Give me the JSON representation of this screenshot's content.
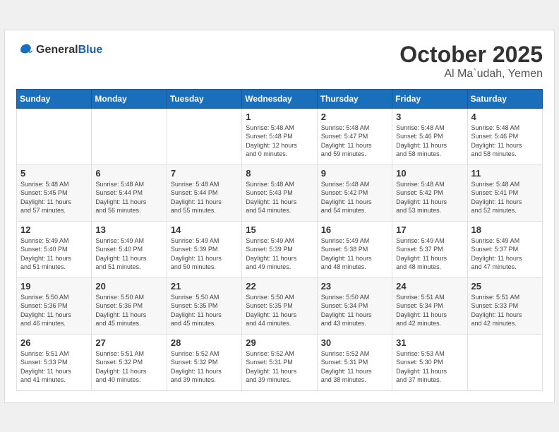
{
  "header": {
    "logo": {
      "general": "General",
      "blue": "Blue"
    },
    "month": "October 2025",
    "location": "Al Ma`udah, Yemen"
  },
  "weekdays": [
    "Sunday",
    "Monday",
    "Tuesday",
    "Wednesday",
    "Thursday",
    "Friday",
    "Saturday"
  ],
  "weeks": [
    [
      {
        "day": "",
        "info": ""
      },
      {
        "day": "",
        "info": ""
      },
      {
        "day": "",
        "info": ""
      },
      {
        "day": "1",
        "info": "Sunrise: 5:48 AM\nSunset: 5:48 PM\nDaylight: 12 hours\nand 0 minutes."
      },
      {
        "day": "2",
        "info": "Sunrise: 5:48 AM\nSunset: 5:47 PM\nDaylight: 11 hours\nand 59 minutes."
      },
      {
        "day": "3",
        "info": "Sunrise: 5:48 AM\nSunset: 5:46 PM\nDaylight: 11 hours\nand 58 minutes."
      },
      {
        "day": "4",
        "info": "Sunrise: 5:48 AM\nSunset: 5:46 PM\nDaylight: 11 hours\nand 58 minutes."
      }
    ],
    [
      {
        "day": "5",
        "info": "Sunrise: 5:48 AM\nSunset: 5:45 PM\nDaylight: 11 hours\nand 57 minutes."
      },
      {
        "day": "6",
        "info": "Sunrise: 5:48 AM\nSunset: 5:44 PM\nDaylight: 11 hours\nand 56 minutes."
      },
      {
        "day": "7",
        "info": "Sunrise: 5:48 AM\nSunset: 5:44 PM\nDaylight: 11 hours\nand 55 minutes."
      },
      {
        "day": "8",
        "info": "Sunrise: 5:48 AM\nSunset: 5:43 PM\nDaylight: 11 hours\nand 54 minutes."
      },
      {
        "day": "9",
        "info": "Sunrise: 5:48 AM\nSunset: 5:42 PM\nDaylight: 11 hours\nand 54 minutes."
      },
      {
        "day": "10",
        "info": "Sunrise: 5:48 AM\nSunset: 5:42 PM\nDaylight: 11 hours\nand 53 minutes."
      },
      {
        "day": "11",
        "info": "Sunrise: 5:48 AM\nSunset: 5:41 PM\nDaylight: 11 hours\nand 52 minutes."
      }
    ],
    [
      {
        "day": "12",
        "info": "Sunrise: 5:49 AM\nSunset: 5:40 PM\nDaylight: 11 hours\nand 51 minutes."
      },
      {
        "day": "13",
        "info": "Sunrise: 5:49 AM\nSunset: 5:40 PM\nDaylight: 11 hours\nand 51 minutes."
      },
      {
        "day": "14",
        "info": "Sunrise: 5:49 AM\nSunset: 5:39 PM\nDaylight: 11 hours\nand 50 minutes."
      },
      {
        "day": "15",
        "info": "Sunrise: 5:49 AM\nSunset: 5:39 PM\nDaylight: 11 hours\nand 49 minutes."
      },
      {
        "day": "16",
        "info": "Sunrise: 5:49 AM\nSunset: 5:38 PM\nDaylight: 11 hours\nand 48 minutes."
      },
      {
        "day": "17",
        "info": "Sunrise: 5:49 AM\nSunset: 5:37 PM\nDaylight: 11 hours\nand 48 minutes."
      },
      {
        "day": "18",
        "info": "Sunrise: 5:49 AM\nSunset: 5:37 PM\nDaylight: 11 hours\nand 47 minutes."
      }
    ],
    [
      {
        "day": "19",
        "info": "Sunrise: 5:50 AM\nSunset: 5:36 PM\nDaylight: 11 hours\nand 46 minutes."
      },
      {
        "day": "20",
        "info": "Sunrise: 5:50 AM\nSunset: 5:36 PM\nDaylight: 11 hours\nand 45 minutes."
      },
      {
        "day": "21",
        "info": "Sunrise: 5:50 AM\nSunset: 5:35 PM\nDaylight: 11 hours\nand 45 minutes."
      },
      {
        "day": "22",
        "info": "Sunrise: 5:50 AM\nSunset: 5:35 PM\nDaylight: 11 hours\nand 44 minutes."
      },
      {
        "day": "23",
        "info": "Sunrise: 5:50 AM\nSunset: 5:34 PM\nDaylight: 11 hours\nand 43 minutes."
      },
      {
        "day": "24",
        "info": "Sunrise: 5:51 AM\nSunset: 5:34 PM\nDaylight: 11 hours\nand 42 minutes."
      },
      {
        "day": "25",
        "info": "Sunrise: 5:51 AM\nSunset: 5:33 PM\nDaylight: 11 hours\nand 42 minutes."
      }
    ],
    [
      {
        "day": "26",
        "info": "Sunrise: 5:51 AM\nSunset: 5:33 PM\nDaylight: 11 hours\nand 41 minutes."
      },
      {
        "day": "27",
        "info": "Sunrise: 5:51 AM\nSunset: 5:32 PM\nDaylight: 11 hours\nand 40 minutes."
      },
      {
        "day": "28",
        "info": "Sunrise: 5:52 AM\nSunset: 5:32 PM\nDaylight: 11 hours\nand 39 minutes."
      },
      {
        "day": "29",
        "info": "Sunrise: 5:52 AM\nSunset: 5:31 PM\nDaylight: 11 hours\nand 39 minutes."
      },
      {
        "day": "30",
        "info": "Sunrise: 5:52 AM\nSunset: 5:31 PM\nDaylight: 11 hours\nand 38 minutes."
      },
      {
        "day": "31",
        "info": "Sunrise: 5:53 AM\nSunset: 5:30 PM\nDaylight: 11 hours\nand 37 minutes."
      },
      {
        "day": "",
        "info": ""
      }
    ]
  ]
}
